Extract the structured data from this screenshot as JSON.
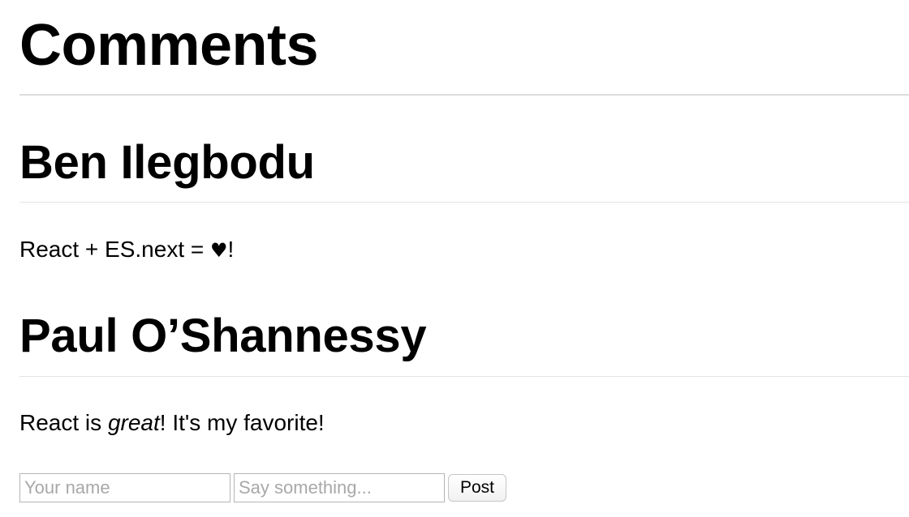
{
  "page": {
    "title": "Comments"
  },
  "comments": [
    {
      "author": "Ben Ilegbodu",
      "text_before": "React + ES.next = ",
      "heart": "♥",
      "text_after": "!"
    },
    {
      "author": "Paul O’Shannessy",
      "text_before": "React is ",
      "emphasis": "great",
      "text_after": "! It's my favorite!"
    }
  ],
  "form": {
    "name_placeholder": "Your name",
    "name_value": "",
    "text_placeholder": "Say something...",
    "text_value": "",
    "submit_label": "Post"
  }
}
